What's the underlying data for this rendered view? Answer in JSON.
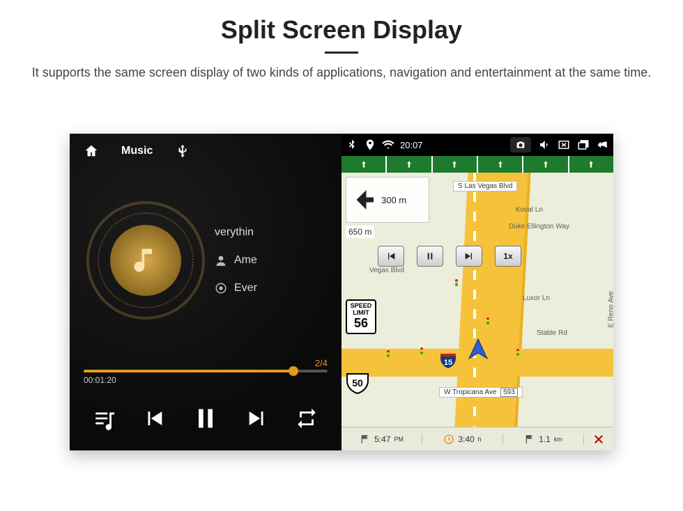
{
  "page": {
    "title": "Split Screen Display",
    "subtitle": "It supports the same screen display of two kinds of applications, navigation and entertainment at the same time."
  },
  "music": {
    "app_label": "Music",
    "source_icon": "usb-icon",
    "track": "verythin",
    "artist": "Ame",
    "album": "Ever",
    "index": "2/4",
    "elapsed": "00:01:20",
    "remaining": "",
    "progress_pct": 86
  },
  "status": {
    "time": "20:07",
    "icons": [
      "bluetooth",
      "location",
      "wifi"
    ]
  },
  "nav": {
    "turn_dist": "300 m",
    "approach_dist": "650 m",
    "playback_speed": "1x",
    "speed_limit_label": "SPEED LIMIT",
    "speed_limit_value": "56",
    "current_route": "50",
    "interstate": "15",
    "streets": {
      "top": "S Las Vegas Blvd",
      "mid1": "Koval Ln",
      "mid2": "Duke Ellington Way",
      "left": "Vegas Blvd",
      "right1": "Luxor Ln",
      "right2": "Stable Rd",
      "rightv": "E Reno Ave",
      "bottom": "W Tropicana Ave",
      "bottom_num": "593"
    },
    "trip": {
      "eta": "5:47",
      "eta_unit": "PM",
      "duration": "3:40",
      "duration_unit": "h",
      "distance": "1.1",
      "distance_unit": "km"
    }
  }
}
